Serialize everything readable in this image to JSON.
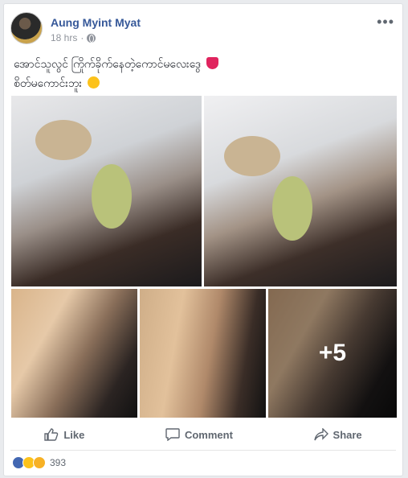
{
  "post": {
    "author": "Aung Myint Myat",
    "time": "18 hrs",
    "more": "•••",
    "text_line1": "အောင်သူလွင် ကြိုက်ခိုက်နေတဲ့ကောင်မလေးဒွေ",
    "text_line2": "စိတ်မကောင်းဘူး",
    "photo_overlay": "+5"
  },
  "actions": {
    "like": "Like",
    "comment": "Comment",
    "share": "Share"
  },
  "reactions": {
    "count": "393"
  },
  "colors": {
    "name": "#365899",
    "like_reaction": "#4267b2",
    "heart_emoji": "#e0245e"
  }
}
